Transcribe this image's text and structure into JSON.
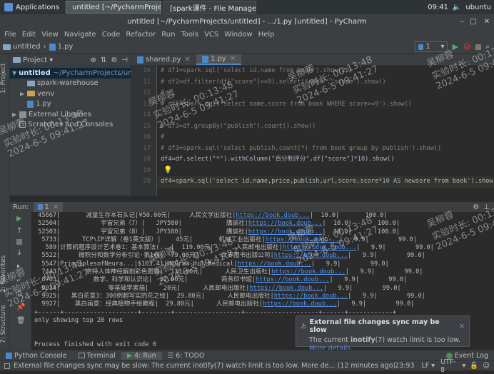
{
  "taskbar": {
    "applications": "Applications",
    "task1": "untitled [~/PycharmProjects/untitled]",
    "task2": "[spark课件 - File Manager]",
    "clock": "09:41",
    "user": "ubuntu"
  },
  "window_title": "untitled [~/PycharmProjects/untitled] - .../1.py [untitled] - PyCharm",
  "menu": [
    "File",
    "Edit",
    "View",
    "Navigate",
    "Code",
    "Refactor",
    "Run",
    "Tools",
    "VCS",
    "Window",
    "Help"
  ],
  "breadcrumb": {
    "project": "untitled",
    "file": "1.py"
  },
  "run_config": "1",
  "project_panel": {
    "title": "Project",
    "items": [
      {
        "label": "untitled",
        "path": "~/PycharmProjects/unt",
        "type": "folder"
      },
      {
        "label": "spark-warehouse",
        "type": "folder"
      },
      {
        "label": "venv",
        "type": "folder"
      },
      {
        "label": "1.py",
        "type": "python"
      },
      {
        "label": "External Libraries",
        "type": "lib"
      },
      {
        "label": "Scratches and Consoles",
        "type": "scratch"
      }
    ]
  },
  "editor_tabs": [
    "shared.py",
    "1.py"
  ],
  "code_lines": [
    {
      "n": "10",
      "text": "# df1=spark.sql('select id,name from book').show(20)",
      "cls": "cm"
    },
    {
      "n": "11",
      "text": "# df2=df.filter(df[\"score\"]>=9).select(\"name\",\"score\").show()",
      "cls": "cm"
    },
    {
      "n": "12",
      "text": "#",
      "cls": "cm"
    },
    {
      "n": "13",
      "text": "# df2=spark.sql('select name,score from book WHERE score>=9').show()",
      "cls": "cm"
    },
    {
      "n": "14",
      "text": "",
      "cls": ""
    },
    {
      "n": "15",
      "text": "# df3=df.groupBy(\"publish\").count().show()",
      "cls": "cm"
    },
    {
      "n": "16",
      "text": "#",
      "cls": "cm"
    },
    {
      "n": "17",
      "text": "# df3=spark.sql('select publish,count(*) from book group by publish').show()",
      "cls": "cm"
    },
    {
      "n": "18",
      "text": "df4=df.select(\"*\").withColumn(\"百分制评分\",df[\"score\"]*10).show()",
      "cls": ""
    },
    {
      "n": "19",
      "text": "",
      "cls": ""
    },
    {
      "n": "20",
      "text": "df4=spark.sql('select id,name,price,publish,url,score,score*10 AS newsore from book').show()",
      "cls": "hl"
    }
  ],
  "run_panel": {
    "title": "Run:",
    "tab": "1"
  },
  "console_rows": [
    " 45667|       减量生存本石头记|¥50.00元|     人民文学出版社|https://book.doub...|  10.0|       100.0|",
    " 52504|           宇宙兄弟（7）|   JPY580|            講談社|https://book.doub...|  10.0|       100.0|",
    " 52503|           宇宙兄弟（8）|   JPY580|            講談社|https://book.doub...|  10.0|       100.0|",
    "  5733|      TCP\\IP详解（卷1英文版）|    45元|       机械工业出版社|https://book.doub...|   9.9|        99.0|",
    "   589|计算机程序设计艺术卷1：基本算法(...|  119.00元|      人民邮电出版社|https://book.doub...|   9.9|        99.0|",
    "  5522|     微积分和数学分析引论·第1卷|  79.00元|      世界图书出版公司|https://book.doub...|   9.9|        99.0|",
    "  5547|PrinciplesofNeura...|$103.41|McGraw-HillMedical|https://book.doub...|   9.9|        99.0|",
    "  7443|       奈特人体神经解剖彩色图谱|  138.00元|      人民卫生出版社|https://book.doub...|   9.9|        99.0|",
    "  8703|         数学、科学和认识论|  32.00元|         商务印书馆|https://book.doub...|   9.9|        99.0|",
    "  9924|             零基础学素描|    20元|      人民邮电出版社|https://book.doub...|   9.9|        99.0|",
    "  9925|   黑白花意3：300例超写实的花之绘|  29.80元|      人民邮电出版社|https://book.doub...|   9.9|        99.0|",
    "  9927|    黑白画意：经典植物手绘教程|  29.80元|      人民邮电出版社|https://book.doub...|   9.9|        99.0|",
    "+------+--------------------+--------+------------------+--------------------+------+------------+",
    "only showing top 20 rows",
    "",
    "",
    "Process finished with exit code 0"
  ],
  "toast": {
    "title": "External file changes sync may be slow",
    "body_pre": "The current ",
    "body_bold": "inotify",
    "body_post": "(7) watch limit is too low.",
    "link": "More details."
  },
  "bottom_tabs": [
    "Python Console",
    "Terminal",
    "4: Run",
    "6: TODO"
  ],
  "event_log": "Event Log",
  "status": {
    "message": "External file changes sync may be slow: The current inotify(7) watch limit is too low. More de... (12 minutes ago)",
    "position": "23:93",
    "line_sep": "LF",
    "encoding": "UTF-8"
  },
  "left_stripe_tabs": [
    "1: Project",
    "2: Favorites",
    "7: Structure"
  ],
  "watermark": {
    "name": "吴柳蓉",
    "duration": "实验时长: 00:13:48",
    "date": "2024-6-5 09:41:27"
  }
}
